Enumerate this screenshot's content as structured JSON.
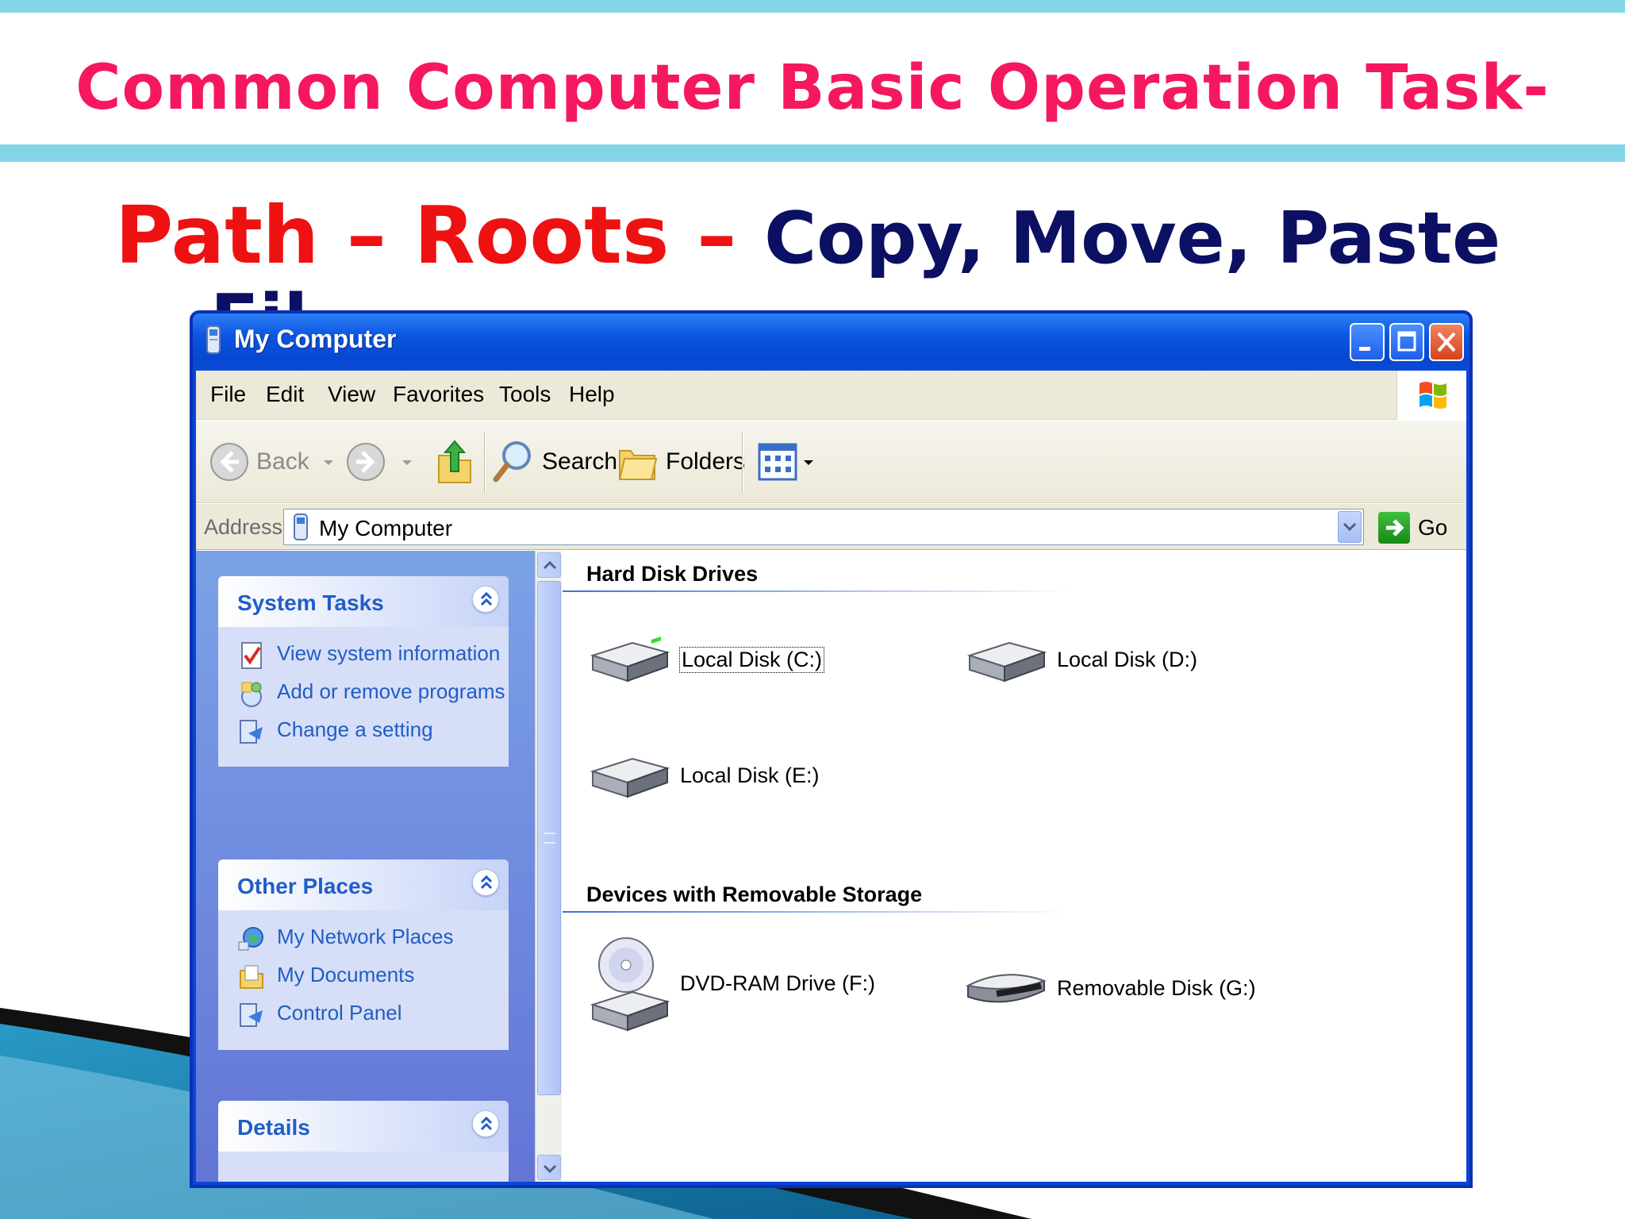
{
  "slide": {
    "title": "Common Computer Basic Operation Task-",
    "subtitle_part1": "Path – Roots – ",
    "subtitle_part2": "Copy, Move, Paste",
    "subtitle_overflow": "Fil",
    "colors": {
      "title": "#f5185e",
      "path_roots": "#ee1111",
      "copy_move_paste": "#0b1063",
      "band": "#83d6e8"
    }
  },
  "window": {
    "title": "My Computer",
    "title_icon": "my-computer-icon",
    "controls": [
      "minimize-icon",
      "maximize-icon",
      "close-icon"
    ],
    "menu": [
      "File",
      "Edit",
      "View",
      "Favorites",
      "Tools",
      "Help"
    ],
    "toolbar": {
      "back": "Back",
      "search": "Search",
      "folders": "Folders"
    },
    "address": {
      "label": "Address",
      "value": "My Computer",
      "go": "Go"
    },
    "left_pane": {
      "system_tasks": {
        "title": "System Tasks",
        "items": [
          "View system information",
          "Add or remove programs",
          "Change a setting"
        ]
      },
      "other_places": {
        "title": "Other Places",
        "items": [
          "My Network Places",
          "My Documents",
          "Control Panel"
        ]
      },
      "details": {
        "title": "Details"
      }
    },
    "content": {
      "hard_disk_drives": {
        "title": "Hard Disk Drives",
        "drives": [
          "Local Disk (C:)",
          "Local Disk (D:)",
          "Local Disk (E:)"
        ]
      },
      "removable": {
        "title": "Devices with Removable Storage",
        "drives": [
          "DVD-RAM Drive (F:)",
          "Removable Disk (G:)"
        ]
      }
    }
  }
}
